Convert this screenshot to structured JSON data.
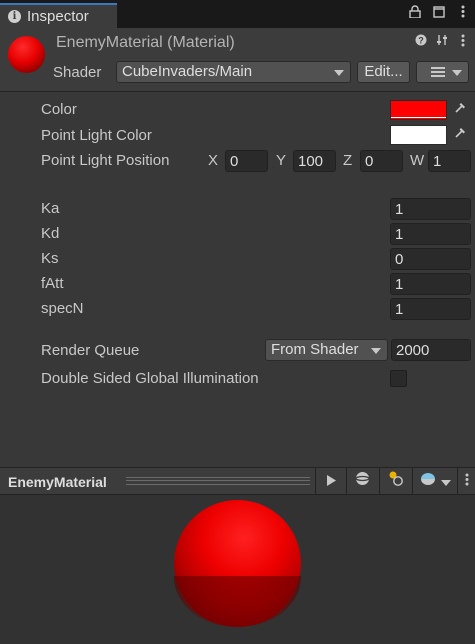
{
  "tab": {
    "title": "Inspector"
  },
  "header": {
    "material_name": "EnemyMaterial (Material)",
    "shader_label": "Shader",
    "shader_value": "CubeInvaders/Main",
    "edit_label": "Edit..."
  },
  "colors": {
    "color_swatch": "#ff0000",
    "point_light_color_swatch": "#ffffff"
  },
  "properties": {
    "color_label": "Color",
    "point_light_color_label": "Point Light Color",
    "point_light_position_label": "Point Light Position",
    "position": {
      "x_label": "X",
      "x_value": "0",
      "y_label": "Y",
      "y_value": "100",
      "z_label": "Z",
      "z_value": "0",
      "w_label": "W",
      "w_value": "1"
    },
    "ka_label": "Ka",
    "ka_value": "1",
    "kd_label": "Kd",
    "kd_value": "1",
    "ks_label": "Ks",
    "ks_value": "0",
    "fatt_label": "fAtt",
    "fatt_value": "1",
    "specn_label": "specN",
    "specn_value": "1"
  },
  "render": {
    "queue_label": "Render Queue",
    "queue_mode": "From Shader",
    "queue_value": "2000",
    "dsgi_label": "Double Sided Global Illumination",
    "dsgi_checked": false
  },
  "preview": {
    "title": "EnemyMaterial"
  },
  "icons": [
    "info-icon",
    "lock-icon",
    "maximize-icon",
    "kebab-menu-icon",
    "help-icon",
    "preset-sliders-icon",
    "eyedropper-icon",
    "play-icon",
    "mesh-sphere-icon",
    "light-icon",
    "preview-background-icon"
  ]
}
